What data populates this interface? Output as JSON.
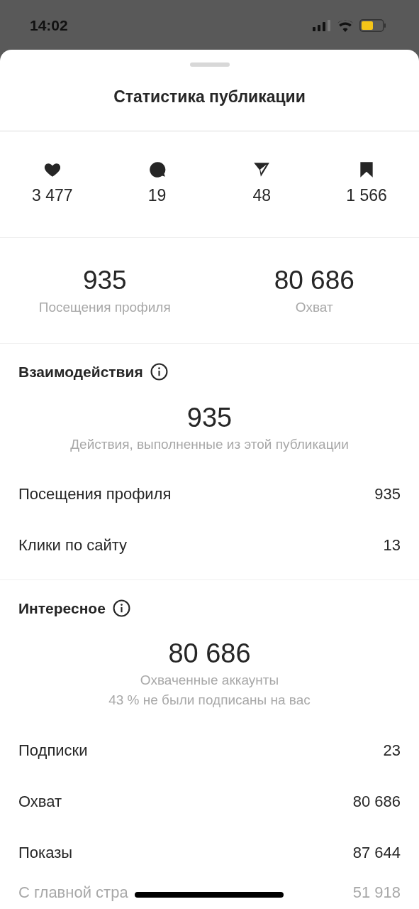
{
  "status_bar": {
    "time": "14:02"
  },
  "title": "Статистика публикации",
  "stats": [
    {
      "kind": "likes",
      "value": "3 477"
    },
    {
      "kind": "comments",
      "value": "19"
    },
    {
      "kind": "shares",
      "value": "48"
    },
    {
      "kind": "saves",
      "value": "1 566"
    }
  ],
  "summary": [
    {
      "value": "935",
      "label": "Посещения профиля"
    },
    {
      "value": "80 686",
      "label": "Охват"
    }
  ],
  "sections": [
    {
      "heading": "Взаимодействия",
      "value": "935",
      "captions": [
        "Действия, выполненные из этой публикации"
      ],
      "rows": [
        {
          "kind": "main",
          "label": "Посещения профиля",
          "value": "935"
        },
        {
          "kind": "main",
          "label": "Клики по сайту",
          "value": "13"
        }
      ]
    },
    {
      "heading": "Интересное",
      "value": "80 686",
      "captions": [
        "Охваченные аккаунты",
        "43 % не были подписаны на вас"
      ],
      "rows": [
        {
          "kind": "main",
          "label": "Подписки",
          "value": "23"
        },
        {
          "kind": "main",
          "label": "Охват",
          "value": "80 686"
        },
        {
          "kind": "main",
          "label": "Показы",
          "value": "87 644"
        },
        {
          "kind": "sub",
          "label": "С главной стра",
          "value": "51 918"
        }
      ]
    }
  ]
}
